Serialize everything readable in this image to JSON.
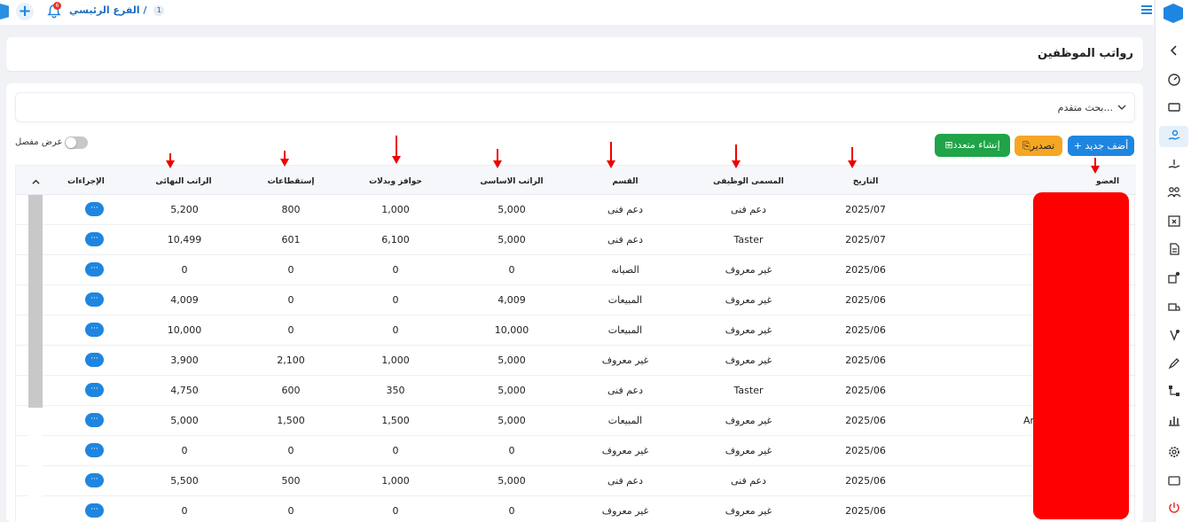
{
  "topbar": {
    "breadcrumb": "الفرع الرئيسي /",
    "branch_number": "1",
    "notification_count": "6",
    "icons": [
      "app-logo-icon",
      "plus-icon",
      "bell-icon",
      "hamburger-menu-icon"
    ]
  },
  "page": {
    "title": "رواتب الموظفين"
  },
  "search": {
    "label": "بحث متقدم..."
  },
  "toolbar": {
    "add_label": "+ أضف جديد",
    "export_label": "تصدير",
    "bulk_create_label": "إنشاء متعدد",
    "detailed_view_label": "عرض مفصل"
  },
  "table": {
    "columns": {
      "member": "العضو",
      "date": "التاريخ",
      "job_title": "المسمى الوظيفى",
      "department": "القسم",
      "base_salary": "الراتب الاساسى",
      "allowances": "حوافز وبدلات",
      "deductions": "إستقطاعات",
      "final_salary": "الراتب النهائى",
      "actions": "الإجراءات"
    },
    "action_label": "···",
    "rows": [
      {
        "member": "",
        "date": "2025/07",
        "job_title": "دعم فنى",
        "department": "دعم فنى",
        "base_salary": "5,000",
        "allowances": "1,000",
        "deductions": "800",
        "final_salary": "5,200"
      },
      {
        "member": "",
        "date": "2025/07",
        "job_title": "Taster",
        "department": "دعم فنى",
        "base_salary": "5,000",
        "allowances": "6,100",
        "deductions": "601",
        "final_salary": "10,499"
      },
      {
        "member": "",
        "date": "2025/06",
        "job_title": "غير معروف",
        "department": "الصيانه",
        "base_salary": "0",
        "allowances": "0",
        "deductions": "0",
        "final_salary": "0"
      },
      {
        "member": "",
        "date": "2025/06",
        "job_title": "غير معروف",
        "department": "المبيعات",
        "base_salary": "4,009",
        "allowances": "0",
        "deductions": "0",
        "final_salary": "4,009"
      },
      {
        "member": "",
        "date": "2025/06",
        "job_title": "غير معروف",
        "department": "المبيعات",
        "base_salary": "10,000",
        "allowances": "0",
        "deductions": "0",
        "final_salary": "10,000"
      },
      {
        "member": "",
        "date": "2025/06",
        "job_title": "غير معروف",
        "department": "غير معروف",
        "base_salary": "5,000",
        "allowances": "1,000",
        "deductions": "2,100",
        "final_salary": "3,900"
      },
      {
        "member": "",
        "date": "2025/06",
        "job_title": "Taster",
        "department": "دعم فنى",
        "base_salary": "5,000",
        "allowances": "350",
        "deductions": "600",
        "final_salary": "4,750"
      },
      {
        "member": "An",
        "date": "2025/06",
        "job_title": "غير معروف",
        "department": "المبيعات",
        "base_salary": "5,000",
        "allowances": "1,500",
        "deductions": "1,500",
        "final_salary": "5,000"
      },
      {
        "member": "",
        "date": "2025/06",
        "job_title": "غير معروف",
        "department": "غير معروف",
        "base_salary": "0",
        "allowances": "0",
        "deductions": "0",
        "final_salary": "0"
      },
      {
        "member": "",
        "date": "2025/06",
        "job_title": "دعم فنى",
        "department": "دعم فنى",
        "base_salary": "5,000",
        "allowances": "1,000",
        "deductions": "500",
        "final_salary": "5,500"
      },
      {
        "member": "",
        "date": "2025/06",
        "job_title": "غير معروف",
        "department": "غير معروف",
        "base_salary": "0",
        "allowances": "0",
        "deductions": "0",
        "final_salary": "0"
      }
    ]
  },
  "sidebar": {
    "items": [
      "chevron-left-icon",
      "dashboard-gauge-icon",
      "ticket-icon",
      "salary-hand-icon",
      "payment-hand-icon",
      "users-group-icon",
      "calendar-x-icon",
      "document-icon",
      "widgets-icon",
      "delivery-truck-icon",
      "badge-check-icon",
      "pen-sign-icon",
      "hierarchy-icon",
      "bar-chart-icon",
      "settings-gear-icon",
      "window-icon",
      "power-icon"
    ]
  },
  "colors": {
    "primary": "#1e86e0",
    "export": "#f5a623",
    "bulk": "#1fa447",
    "annotation_red": "#ff0000"
  }
}
